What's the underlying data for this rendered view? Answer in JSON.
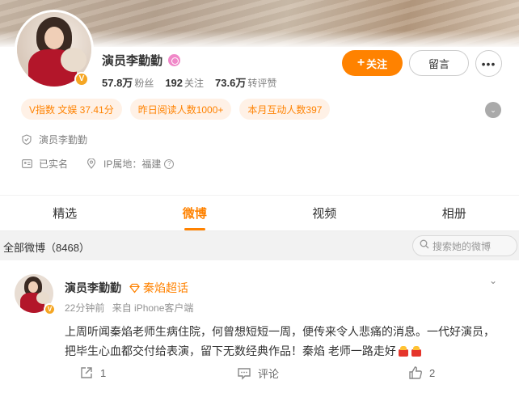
{
  "profile": {
    "name": "演员李勤勤",
    "stats": [
      {
        "num": "57.8万",
        "label": "粉丝"
      },
      {
        "num": "192",
        "label": "关注"
      },
      {
        "num": "73.6万",
        "label": "转评赞"
      }
    ],
    "follow_label": "关注",
    "follow_plus": "+",
    "message_label": "留言",
    "more_label": "•••",
    "tags": [
      "V指数 文娱 37.41分",
      "昨日阅读人数1000+",
      "本月互动人数397"
    ],
    "verified_text": "演员李勤勤",
    "real_name_text": "已实名",
    "ip_text": "IP属地：福建",
    "verified_badge": "V",
    "expand_glyph": "⌄",
    "question_glyph": "?"
  },
  "tabs": [
    {
      "label": "精选"
    },
    {
      "label": "微博"
    },
    {
      "label": "视频"
    },
    {
      "label": "相册"
    }
  ],
  "filter": {
    "all_label": "全部微博（8468）",
    "search_placeholder": "搜索她的微博"
  },
  "post": {
    "author": "演员李勤勤",
    "verified_badge": "V",
    "topic": "秦焰超话",
    "time": "22分钟前",
    "source": "来自 iPhone客户端",
    "text": "上周听闻秦焰老师生病住院，何曾想短短一周，便传来令人悲痛的消息。一代好演员，把毕生心血都交付给表演，留下无数经典作品！秦焰 老师一路走好",
    "caret": "⌄",
    "repost_count": "1",
    "comment_label": "评论",
    "like_count": "2"
  },
  "colors": {
    "accent": "#ff8200",
    "tag_bg": "#fff1e6",
    "verified": "#f5a623"
  }
}
